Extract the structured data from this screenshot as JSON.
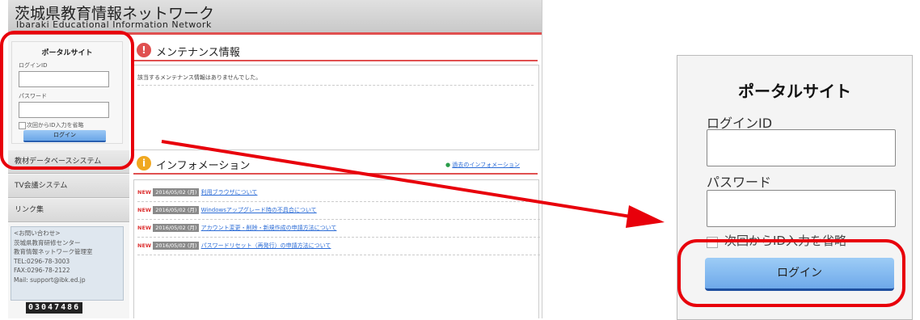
{
  "header": {
    "title": "茨城県教育情報ネットワーク",
    "subtitle": "Ibaraki Educational Information Network"
  },
  "login": {
    "title": "ポータルサイト",
    "id_label": "ログインID",
    "password_label": "パスワード",
    "remember_label": "次回からID入力を省略",
    "button_label": "ログイン"
  },
  "sidebar": {
    "items": [
      {
        "label": "教材データベースシステム"
      },
      {
        "label": "TV会議システム"
      },
      {
        "label": "リンク集"
      }
    ],
    "contact_lines": [
      "<お問い合わせ>",
      "茨城県教育研修センター",
      "教育情報ネットワーク管理室",
      "TEL:0296-78-3003",
      "FAX:0296-78-2122",
      "Mail: support@ibk.ed.jp"
    ],
    "counter": "03047486"
  },
  "maintenance": {
    "title": "メンテナンス情報",
    "message": "該当するメンテナンス情報はありませんでした。"
  },
  "information": {
    "title": "インフォメーション",
    "past_link": "過去のインフォメーション",
    "items": [
      {
        "badge": "NEW",
        "date": "2016/05/02 (月)",
        "text": "利用ブラウザについて"
      },
      {
        "badge": "NEW",
        "date": "2016/05/02 (月)",
        "text": "Windowsアップグレード時の不具合について"
      },
      {
        "badge": "NEW",
        "date": "2016/05/02 (月)",
        "text": "アカウント変更・削除・新規作成の申請方法について"
      },
      {
        "badge": "NEW",
        "date": "2016/05/02 (月)",
        "text": "パスワードリセット（再発行）の申請方法について"
      }
    ]
  },
  "colors": {
    "annotation": "#e8000b",
    "accent_line": "#e05050",
    "button": "#6ea9ea",
    "link": "#2a6bd6"
  }
}
